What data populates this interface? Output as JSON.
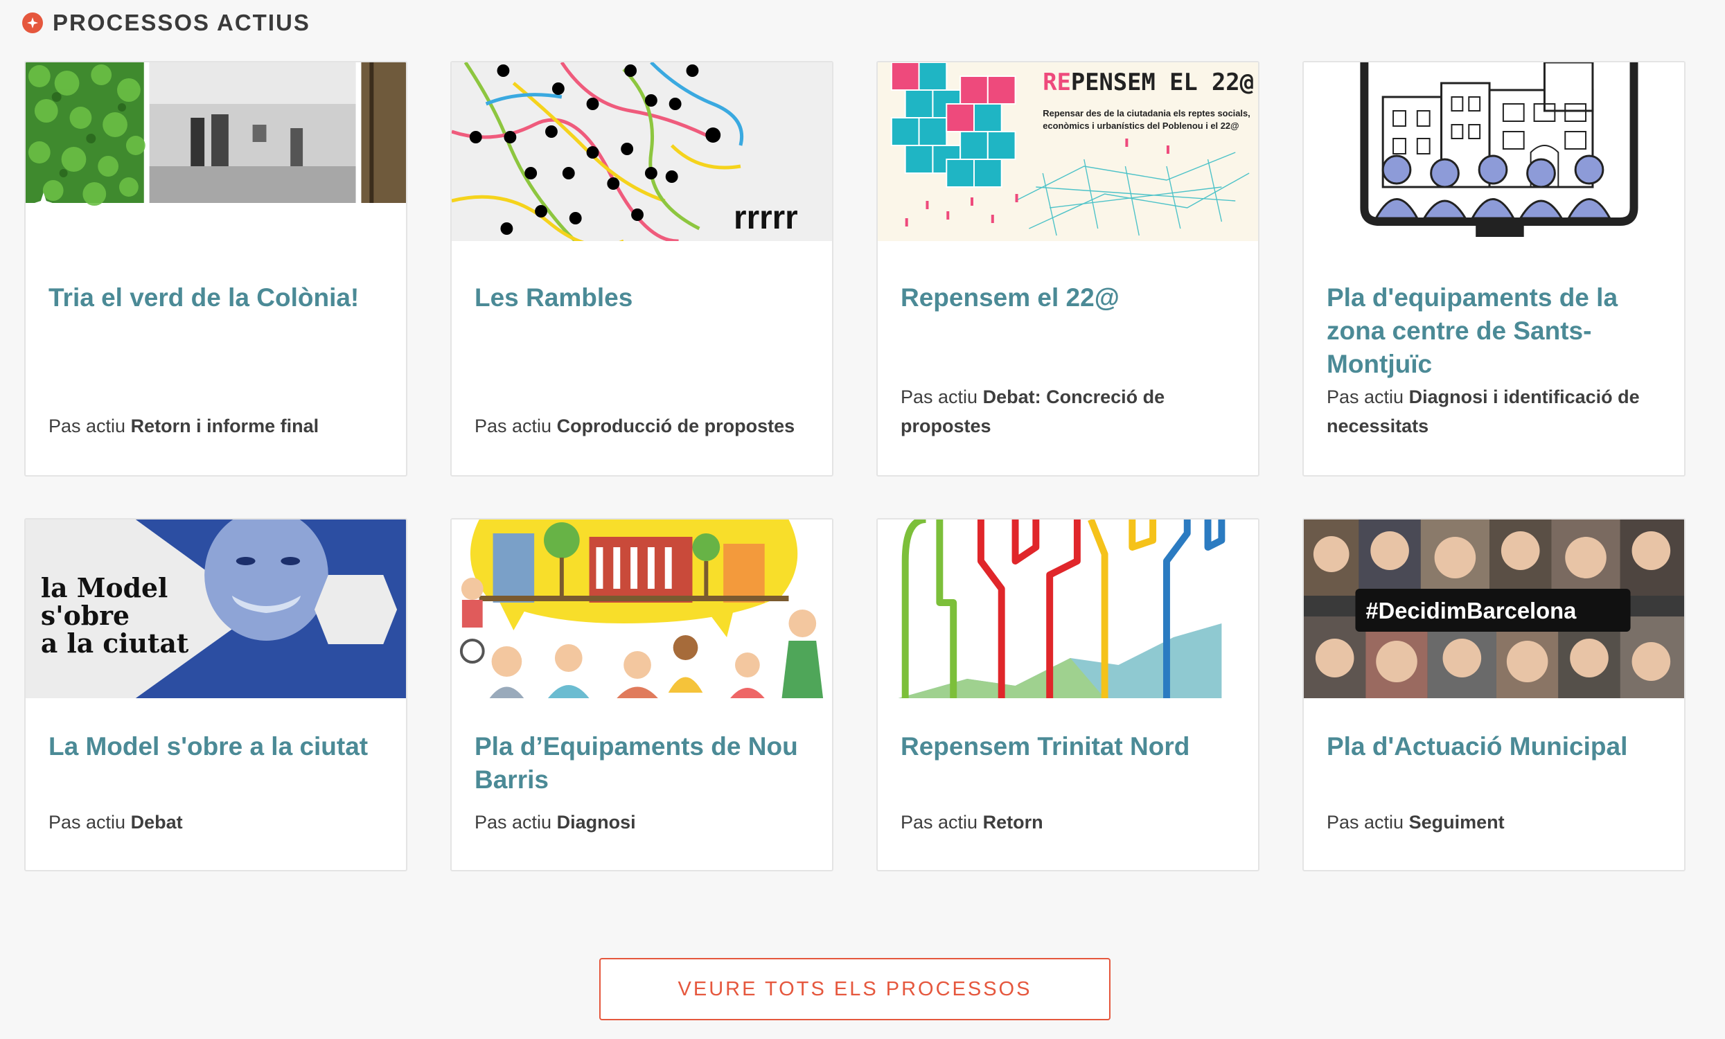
{
  "section": {
    "title": "PROCESSOS ACTIUS"
  },
  "step_prefix": "Pas actiu",
  "processes": [
    {
      "title": "Tria el verd de la Colònia!",
      "step": "Retorn i informe final",
      "image": "clover-and-street-photo"
    },
    {
      "title": "Les Rambles",
      "step": "Coproducció de propostes",
      "image": "network-dots-rrrrr"
    },
    {
      "title": "Repensem el 22@",
      "step": "Debat: Concreció de propostes",
      "image": "repensem-22-cubes",
      "image_heading": "REPENSEM EL 22@",
      "image_subheading": "Repensar des de la ciutadania els reptes socials, econòmics i urbanístics del Poblenou i el 22@"
    },
    {
      "title": "Pla d'equipaments de la zona centre de Sants-Montjuïc",
      "step": "Diagnosi i identificació de necessitats",
      "image": "buildings-audience-illustration"
    },
    {
      "title": "La Model s'obre a la ciutat",
      "step": "Debat",
      "image": "la-model-smiling-woman",
      "image_text": [
        "la Model",
        "s'obre",
        "a la ciutat"
      ]
    },
    {
      "title": "Pla d’Equipaments de Nou Barris",
      "step": "Diagnosi",
      "image": "nou-barris-speech-bubble"
    },
    {
      "title": "Repensem Trinitat Nord",
      "step": "Retorn",
      "image": "raised-fists-lines"
    },
    {
      "title": "Pla d'Actuació Municipal",
      "step": "Seguiment",
      "image": "decidim-barcelona-collage",
      "image_tag": "#DecidimBarcelona"
    }
  ],
  "button": {
    "label": "VEURE TOTS ELS PROCESSOS"
  },
  "colors": {
    "accent": "#e5573d",
    "title_link": "#4b8a96",
    "background": "#f7f7f7"
  }
}
